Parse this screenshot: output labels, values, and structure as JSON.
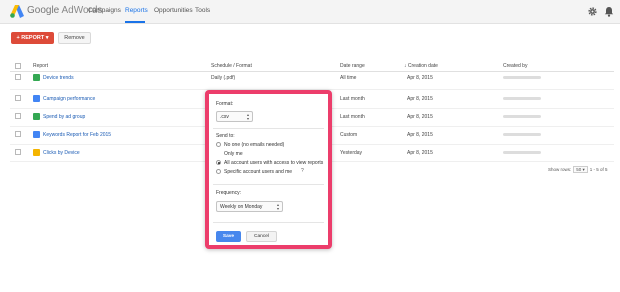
{
  "app": {
    "logo_text": "Google",
    "logo_suffix": "AdWords",
    "nav": [
      {
        "label": "Campaigns"
      },
      {
        "label": "Reports"
      },
      {
        "label": "Opportunities"
      },
      {
        "label": "Tools"
      }
    ],
    "active_nav": "Reports"
  },
  "toolbar": {
    "report_label": "+ REPORT ▾",
    "remove_label": "Remove"
  },
  "table": {
    "headers": {
      "report": "Report",
      "schedule": "Schedule / Format",
      "date_range": "Date range",
      "creation": "↓ Creation date",
      "created_by": "Created by"
    },
    "rows": [
      {
        "name": "Device trends",
        "schedule": "Daily (.pdf)",
        "date_range": "All time",
        "creation": "Apr 8, 2015",
        "icon_color": "#34a853"
      },
      {
        "name": "Campaign performance",
        "schedule": "",
        "date_range": "Last month",
        "creation": "Apr 8, 2015",
        "icon_color": "#4285f4"
      },
      {
        "name": "Spend by ad group",
        "schedule": "",
        "date_range": "Last month",
        "creation": "Apr 8, 2015",
        "icon_color": "#34a853"
      },
      {
        "name": "Keywords Report for Feb 2015",
        "schedule": "",
        "date_range": "Custom",
        "creation": "Apr 8, 2015",
        "icon_color": "#4285f4"
      },
      {
        "name": "Clicks by Device",
        "schedule": "",
        "date_range": "Yesterday",
        "creation": "Apr 8, 2015",
        "icon_color": "#f4b400"
      }
    ]
  },
  "pagination": {
    "show_rows_label": "Show rows:",
    "rows_value": "50",
    "range": "1 - 5 of 5"
  },
  "popup": {
    "format_label": "Format:",
    "format_value": ".csv",
    "send_to_label": "Send to:",
    "options": [
      {
        "label": "No one (no emails needed)",
        "checked": false
      },
      {
        "label": "Only me",
        "checked": false
      },
      {
        "label": "All account users with access to view reports",
        "checked": true
      },
      {
        "label": "Specific account users and me",
        "checked": false
      }
    ],
    "frequency_label": "Frequency:",
    "frequency_value": "Weekly on Monday",
    "save_label": "Save",
    "cancel_label": "Cancel"
  },
  "colors": {
    "accent_blue": "#1a73e8",
    "report_button": "#dd4b39",
    "highlight_border": "#ec3d6b",
    "save_button": "#4787ed"
  }
}
